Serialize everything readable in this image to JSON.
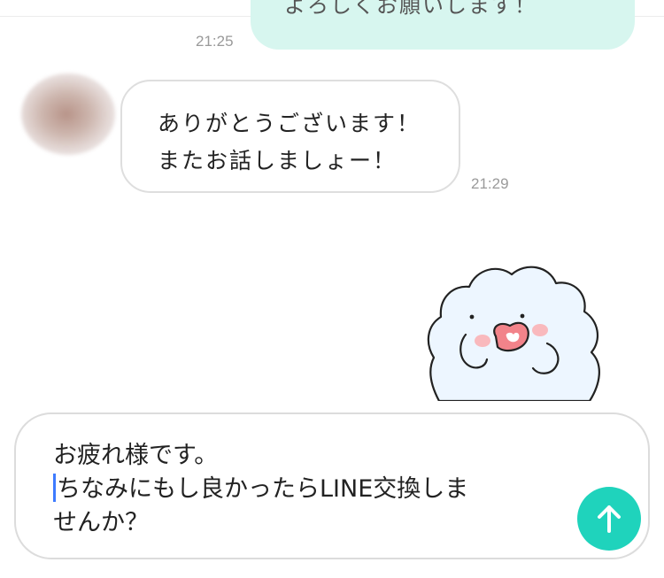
{
  "chat": {
    "outgoing_message": "よろしくお願いします！",
    "outgoing_time": "21:25",
    "incoming_message_line1": "ありがとうございます！",
    "incoming_message_line2": "またお話しましょー！",
    "incoming_time": "21:29"
  },
  "composer": {
    "line1": "お疲れ様です。",
    "line2": "ちなみにもし良かったらLINE交換しま",
    "line3": "せんか？"
  },
  "icons": {
    "send": "arrow-up-icon",
    "sticker": "fluffy-cloud-character-sticker"
  },
  "colors": {
    "outgoing_bubble": "#d7f6ef",
    "send_button": "#1fd3bc",
    "caret": "#3d7bff"
  }
}
